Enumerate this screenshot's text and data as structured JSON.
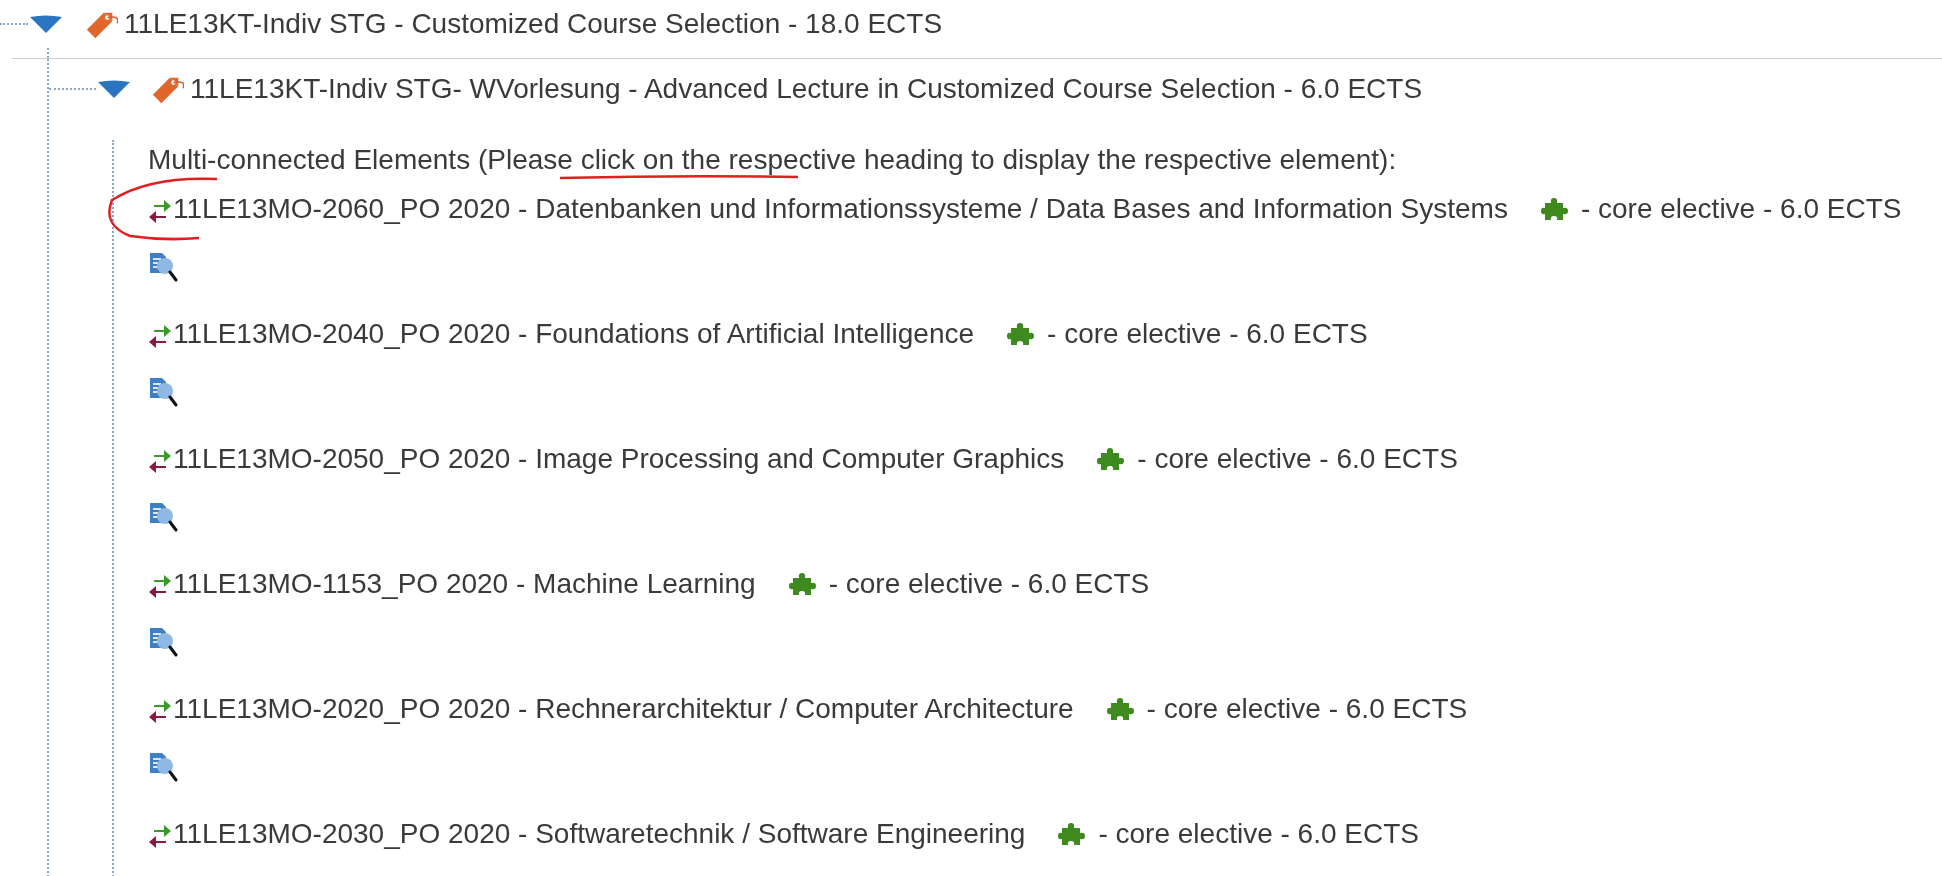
{
  "tree": {
    "label": "11LE13KT-Indiv STG - Customized Course Selection - 18.0 ECTS",
    "expanded": true,
    "children": [
      {
        "label": "11LE13KT-Indiv STG- WVorlesung - Advanced Lecture in Customized Course Selection - 6.0 ECTS",
        "expanded": true,
        "note": "Multi-connected Elements (Please click on the respective heading to display the respective element):",
        "elements": [
          {
            "title": "11LE13MO-2060_PO 2020 - Datenbanken und Informationssysteme / Data Bases and Information Systems",
            "category": "- core elective - 6.0 ECTS"
          },
          {
            "title": "11LE13MO-2040_PO 2020 - Foundations of Artificial Intelligence",
            "category": "- core elective - 6.0 ECTS"
          },
          {
            "title": "11LE13MO-2050_PO 2020 - Image Processing and Computer Graphics",
            "category": "- core elective - 6.0 ECTS"
          },
          {
            "title": "11LE13MO-1153_PO 2020 - Machine Learning",
            "category": "- core elective - 6.0 ECTS"
          },
          {
            "title": "11LE13MO-2020_PO 2020 - Rechnerarchitektur / Computer Architecture",
            "category": "- core elective - 6.0 ECTS"
          },
          {
            "title": "11LE13MO-2030_PO 2020 - Softwaretechnik / Software Engineering",
            "category": "- core elective - 6.0 ECTS"
          }
        ]
      }
    ]
  }
}
